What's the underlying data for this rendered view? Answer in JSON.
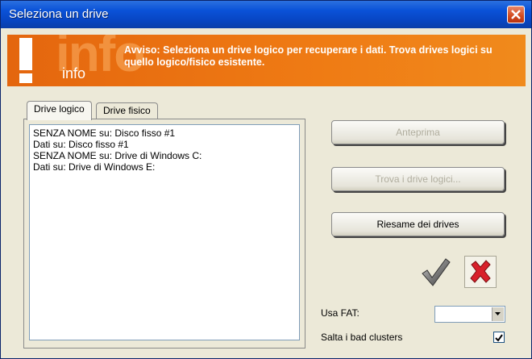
{
  "window": {
    "title": "Seleziona un drive"
  },
  "banner": {
    "info_ghost": "info",
    "info_word": "info",
    "warning": "Avviso: Seleziona un drive logico per recuperare i dati. Trova drives logici su quello logico/fisico esistente."
  },
  "tabs": [
    {
      "label": "Drive logico",
      "active": true
    },
    {
      "label": "Drive fisico",
      "active": false
    }
  ],
  "drive_list": [
    "SENZA NOME   su: Disco fisso #1",
    "Dati   su: Disco fisso #1",
    "SENZA NOME   su: Drive di Windows C:",
    "Dati   su: Drive di Windows E:"
  ],
  "buttons": {
    "preview": "Anteprima",
    "find_logical": "Trova i drive logici...",
    "rescan": "Riesame dei drives"
  },
  "options": {
    "fat_label": "Usa FAT:",
    "fat_value": "",
    "skip_bad_label": "Salta i bad clusters",
    "skip_bad_checked": true
  },
  "icons": {
    "ok": "checkmark-icon",
    "cancel": "red-x-icon",
    "close": "close-icon",
    "warning": "exclamation-icon"
  },
  "colors": {
    "titlebar": "#0a52d8",
    "banner": "#ef7b14",
    "close_button": "#d24a1e",
    "cancel_red": "#d8202a"
  }
}
